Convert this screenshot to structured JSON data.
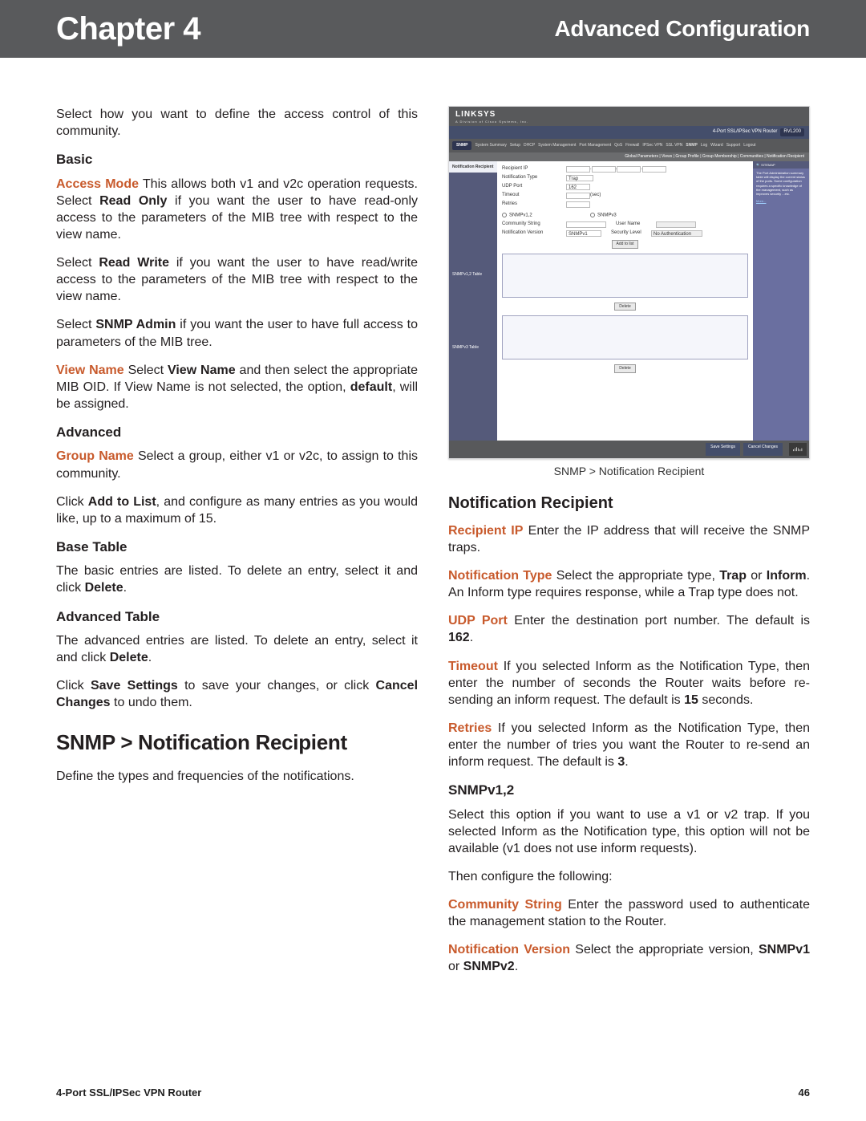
{
  "header": {
    "chapter": "Chapter 4",
    "section_title": "Advanced Configuration"
  },
  "footer": {
    "product": "4-Port SSL/IPSec VPN Router",
    "page": "46"
  },
  "left": {
    "intro": "Select how you want to define the access control of this community.",
    "basic_h": "Basic",
    "access_mode_term": "Access Mode",
    "access_mode_txt": " This allows both v1 and v2c operation requests. Select ",
    "access_mode_b1": "Read Only",
    "access_mode_txt2": " if you want the user to have read-only access to the parameters of the MIB tree with respect to the view name.",
    "rw1": "Select ",
    "rw_b": "Read Write",
    "rw2": " if you want the user to have read/write access to the parameters of the MIB tree with respect to the view name.",
    "sa1": "Select ",
    "sa_b": "SNMP Admin",
    "sa2": " if you want the user to have full access to parameters of the MIB tree.",
    "vn_term": "View Name",
    "vn_txt1": " Select ",
    "vn_b": "View Name",
    "vn_txt2": " and then select the appropriate MIB OID. If View Name is not selected, the option, ",
    "vn_b2": "default",
    "vn_txt3": ", will be assigned.",
    "adv_h": "Advanced",
    "gn_term": "Group Name",
    "gn_txt": "   Select a group, either v1 or v2c, to assign to this community.",
    "atl1": "Click ",
    "atl_b": "Add to List",
    "atl2": ", and configure as many entries as you would like, up to a maximum of 15.",
    "bt_h": "Base Table",
    "bt_txt1": "The basic entries are listed. To delete an entry, select it and click ",
    "bt_b": "Delete",
    "at_h": "Advanced Table",
    "at_txt1": "The advanced entries are listed. To delete an entry, select it and click ",
    "at_b": "Delete",
    "ss1": "Click ",
    "ss_b1": "Save Settings",
    "ss2": " to save your changes, or click ",
    "ss_b2": "Cancel Changes",
    "ss3": " to undo them.",
    "main_h": "SNMP > Notification Recipient",
    "main_p": "Define the types and frequencies of the notifications."
  },
  "right": {
    "caption": "SNMP > Notification Recipient",
    "nr_h": "Notification Recipient",
    "rip_term": "Recipient IP",
    "rip_txt": " Enter the IP address that will receive the SNMP traps.",
    "nt_term": "Notification Type",
    "nt_txt1": "  Select the appropriate type, ",
    "nt_b1": "Trap",
    "nt_txt2": " or ",
    "nt_b2": "Inform",
    "nt_txt3": ". An Inform type requires response, while a Trap type does not.",
    "udp_term": "UDP Port",
    "udp_txt1": "   Enter the destination port number. The default is ",
    "udp_b": "162",
    "to_term": "Timeout",
    "to_txt1": "  If you selected Inform as the Notification Type, then enter the number of seconds the Router waits before re-sending an inform request. The default is ",
    "to_b": "15",
    "to_txt2": " seconds.",
    "re_term": "Retries",
    "re_txt1": "  If you selected Inform as the Notification Type, then enter the number of tries you want the Router to re-send an inform request. The default is ",
    "re_b": "3",
    "sv_h": "SNMPv1,2",
    "sv_p1": "Select this option if you want to use a v1 or v2 trap. If you selected Inform as the Notification type, this option will not be available (v1 does not use inform requests).",
    "sv_p2": "Then configure the following:",
    "cs_term": "Community String",
    "cs_txt": " Enter the password used to authenticate the management station to the Router.",
    "nv_term": "Notification Version",
    "nv_txt1": " Select the appropriate version, ",
    "nv_b1": "SNMPv1",
    "nv_txt2": " or ",
    "nv_b2": "SNMPv2",
    "nv_txt3": "."
  },
  "shot": {
    "logo": "LINKSYS",
    "subbrand": "A Division of Cisco Systems, Inc.",
    "model_line": "4-Port SSL/IPSec VPN Router",
    "model": "RVL200",
    "page": "SNMP",
    "tabs": [
      "System Summary",
      "Setup",
      "DHCP",
      "System Management",
      "Port Management",
      "QoS",
      "Firewall",
      "IPSec VPN",
      "SSL VPN",
      "SNMP",
      "Log",
      "Wizard",
      "Support",
      "Logout"
    ],
    "subtabs": "Global Parameters  |  Views  |  Group Profile  |  Group Membership  |  Communities  |  Notification Recipient",
    "nav_active": "Notification Recipient",
    "nav_items": [
      "SNMPv1,2 Table",
      "SNMPv3 Table"
    ],
    "form": {
      "rip": "Recipient IP",
      "nt": "Notification Type",
      "nt_val": "Trap",
      "udp": "UDP Port",
      "udp_val": "162",
      "to": "Timeout",
      "to_unit": "(sec)",
      "re": "Retries",
      "r1": "SNMPv1,2",
      "r2": "SNMPv3",
      "cs": "Community String",
      "un": "User Name",
      "nv": "Notification Version",
      "nv_val": "SNMPv1",
      "sl": "Security Level",
      "sl_val": "No Authentication",
      "add": "Add to list",
      "del": "Delete"
    },
    "side": {
      "title": "SITEMAP",
      "help": "The Port Administration summary table will display the current status of the ports. Some configuration requires a specific knowledge of the management, such as improves security ...etc.",
      "more": "More..."
    },
    "foot": {
      "save": "Save Settings",
      "cancel": "Cancel Changes"
    }
  }
}
